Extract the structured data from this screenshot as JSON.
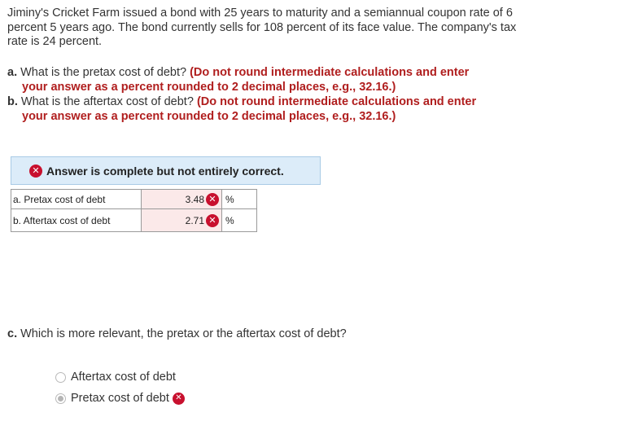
{
  "intro": "Jiminy's Cricket Farm issued a bond with 25 years to maturity and a semiannual coupon rate of 6 percent 5 years ago. The bond currently sells for 108 percent of its face value. The company's tax rate is 24 percent.",
  "question_a": {
    "letter": "a.",
    "text": "What is the pretax cost of debt?",
    "instr_1": "(Do not round intermediate calculations and enter",
    "instr_2": "your answer as a percent rounded to 2 decimal places, e.g., 32.16.)"
  },
  "question_b": {
    "letter": "b.",
    "text": "What is the aftertax cost of debt?",
    "instr_1": "(Do not round intermediate calculations and enter",
    "instr_2": "your answer as a percent rounded to 2 decimal places, e.g., 32.16.)"
  },
  "banner": {
    "text": "Answer is complete but not entirely correct.",
    "icon": "x-circle-icon",
    "color": "#c8102e"
  },
  "answers": [
    {
      "label": "a. Pretax cost of debt",
      "value": "3.48",
      "unit": "%",
      "status": "incorrect"
    },
    {
      "label": "b. Aftertax cost of debt",
      "value": "2.71",
      "unit": "%",
      "status": "incorrect"
    }
  ],
  "question_c": {
    "letter": "c.",
    "text": "Which is more relevant, the pretax or the aftertax cost of debt?",
    "options": [
      {
        "label": "Aftertax cost of debt",
        "selected": false
      },
      {
        "label": "Pretax cost of debt",
        "selected": true,
        "status": "incorrect"
      }
    ]
  },
  "x_symbol": "✕"
}
